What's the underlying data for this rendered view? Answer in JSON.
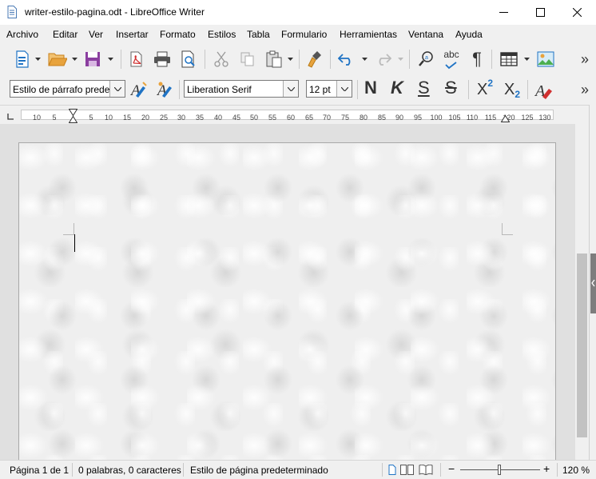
{
  "window": {
    "title": "writer-estilo-pagina.odt - LibreOffice Writer",
    "minimize_label": "—",
    "maximize_label": "☐",
    "close_label": "✕"
  },
  "menu": {
    "items": [
      {
        "label": "Archivo"
      },
      {
        "label": "Editar"
      },
      {
        "label": "Ver"
      },
      {
        "label": "Insertar"
      },
      {
        "label": "Formato"
      },
      {
        "label": "Estilos"
      },
      {
        "label": "Tabla"
      },
      {
        "label": "Formulario"
      },
      {
        "label": "Herramientas"
      },
      {
        "label": "Ventana"
      },
      {
        "label": "Ayuda"
      }
    ]
  },
  "toolbar1": {
    "icons": [
      "new-document-icon",
      "open-folder-icon",
      "save-icon",
      "export-pdf-icon",
      "print-icon",
      "print-preview-icon",
      "cut-icon",
      "copy-icon",
      "paste-icon",
      "clone-formatting-icon",
      "undo-icon",
      "redo-icon",
      "find-replace-icon",
      "spelling-icon",
      "formatting-marks-icon",
      "insert-table-icon",
      "insert-image-icon",
      "more-icon"
    ],
    "spelling_glyph": "abc",
    "pilcrow_glyph": "¶",
    "more_glyph": "»"
  },
  "toolbar2": {
    "paragraph_style": "Estilo de párrafo predeterminado",
    "font_name": "Liberation Serif",
    "font_size": "12 pt",
    "bold_glyph": "N",
    "italic_glyph": "K",
    "underline_glyph": "S",
    "strike_glyph": "S",
    "superscript_glyph": "X",
    "superscript_mark": "2",
    "subscript_glyph": "X",
    "subscript_mark": "2",
    "more_glyph": "»"
  },
  "ruler": {
    "labels": [
      "10",
      "5",
      "5",
      "10",
      "15",
      "20",
      "25",
      "30",
      "35",
      "40",
      "45",
      "50",
      "55",
      "60",
      "65",
      "70",
      "75",
      "80",
      "85",
      "90",
      "95",
      "100",
      "105",
      "110",
      "115",
      "120",
      "125",
      "130"
    ]
  },
  "statusbar": {
    "page": "Página 1 de 1",
    "words": "0 palabras, 0 caracteres",
    "page_style": "Estilo de página predeterminado",
    "zoom_minus": "−",
    "zoom_plus": "+",
    "zoom": "120 %"
  },
  "colors": {
    "save_purple": "#8b3fa0",
    "folder_orange": "#e8a33d",
    "blue_icon": "#1f73c4",
    "accent_red": "#d03030"
  }
}
